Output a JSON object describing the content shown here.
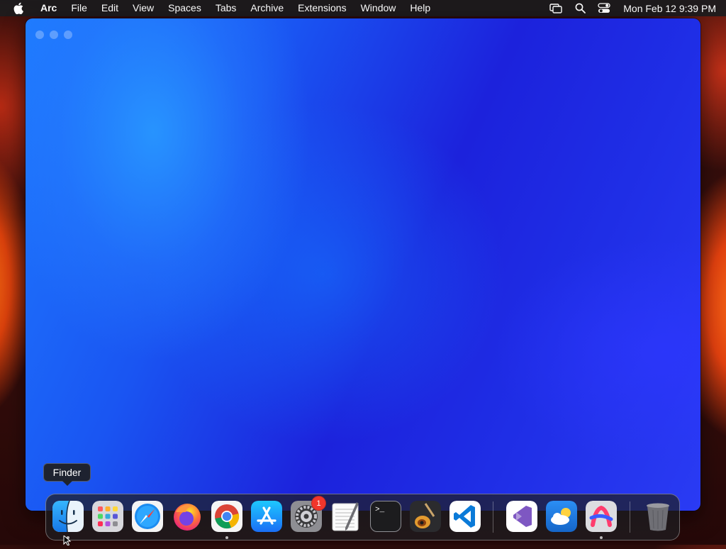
{
  "menubar": {
    "apple_icon": "apple-logo-icon",
    "app_name": "Arc",
    "items": [
      "File",
      "Edit",
      "View",
      "Spaces",
      "Tabs",
      "Archive",
      "Extensions",
      "Window",
      "Help"
    ],
    "status_icons": [
      "screen-mirroring-icon",
      "spotlight-search-icon",
      "control-center-icon"
    ],
    "clock": "Mon Feb 12  9:39 PM"
  },
  "tooltip": {
    "label": "Finder"
  },
  "dock": {
    "apps": [
      {
        "name": "Finder",
        "icon": "finder-icon",
        "running": true
      },
      {
        "name": "Launchpad",
        "icon": "launchpad-icon",
        "running": false
      },
      {
        "name": "Safari",
        "icon": "safari-icon",
        "running": false
      },
      {
        "name": "Firefox",
        "icon": "firefox-icon",
        "running": false
      },
      {
        "name": "Google Chrome",
        "icon": "chrome-icon",
        "running": true
      },
      {
        "name": "App Store",
        "icon": "app-store-icon",
        "running": false
      },
      {
        "name": "System Settings",
        "icon": "system-settings-icon",
        "running": false,
        "badge": "1"
      },
      {
        "name": "TextEdit",
        "icon": "textedit-icon",
        "running": false
      },
      {
        "name": "Terminal",
        "icon": "terminal-icon",
        "running": false
      },
      {
        "name": "GarageBand",
        "icon": "garageband-icon",
        "running": false
      },
      {
        "name": "Visual Studio Code",
        "icon": "vscode-icon",
        "running": false
      },
      {
        "name": "Visual Studio",
        "icon": "visual-studio-icon",
        "running": false
      },
      {
        "name": "Weather",
        "icon": "weather-icon",
        "running": false
      },
      {
        "name": "Arc",
        "icon": "arc-icon",
        "running": true
      },
      {
        "name": "Trash",
        "icon": "trash-icon",
        "running": false
      }
    ],
    "terminal_prompt": ">_"
  }
}
